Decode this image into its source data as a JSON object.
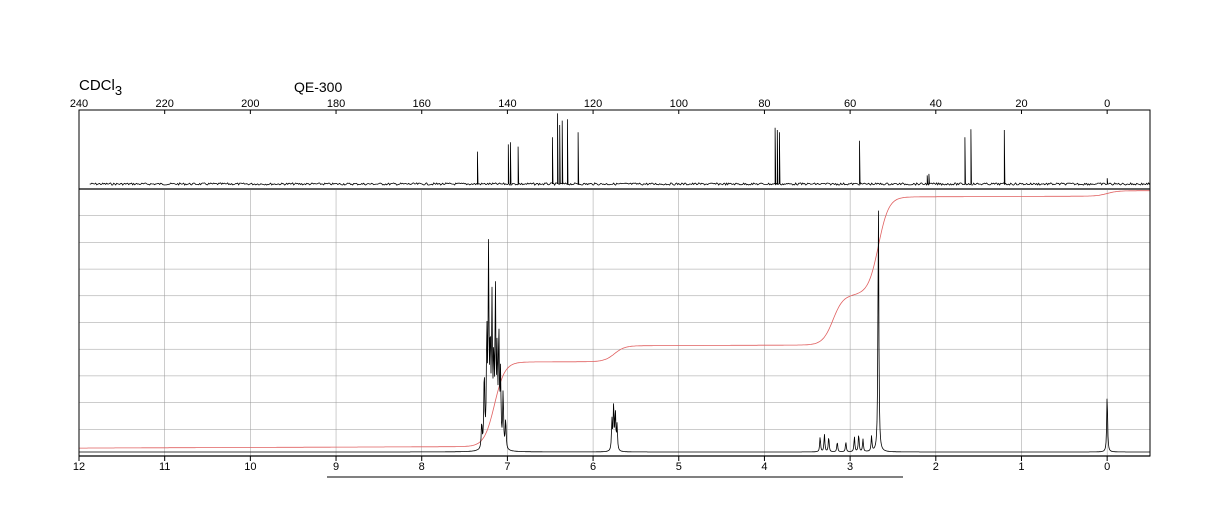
{
  "header": {
    "solvent_main": "CDCl",
    "solvent_sub": "3",
    "instrument": "QE-300"
  },
  "chart_data": [
    {
      "type": "line",
      "name_note": "13C NMR spectrum (top panel)",
      "x_ticks": [
        240,
        220,
        200,
        180,
        160,
        140,
        120,
        100,
        80,
        60,
        40,
        20,
        0
      ],
      "x_tick_labels": [
        "240",
        "220",
        "200",
        "180",
        "160",
        "140",
        "120",
        "100",
        "80",
        "60",
        "40",
        "20",
        "0"
      ],
      "xlim": [
        240,
        -10
      ],
      "x_reversed": true,
      "grid": false,
      "peaks": [
        {
          "ppm": 147.0,
          "h": 0.45
        },
        {
          "ppm": 139.8,
          "h": 0.55
        },
        {
          "ppm": 139.3,
          "h": 0.58
        },
        {
          "ppm": 137.5,
          "h": 0.52
        },
        {
          "ppm": 129.5,
          "h": 0.65
        },
        {
          "ppm": 128.3,
          "h": 0.98
        },
        {
          "ppm": 127.8,
          "h": 0.82
        },
        {
          "ppm": 127.2,
          "h": 0.88
        },
        {
          "ppm": 126.0,
          "h": 0.9
        },
        {
          "ppm": 123.5,
          "h": 0.72
        },
        {
          "ppm": 77.5,
          "h": 0.78
        },
        {
          "ppm": 77.0,
          "h": 0.75
        },
        {
          "ppm": 76.5,
          "h": 0.72
        },
        {
          "ppm": 57.8,
          "h": 0.6
        },
        {
          "ppm": 42.0,
          "h": 0.12
        },
        {
          "ppm": 41.6,
          "h": 0.14
        },
        {
          "ppm": 33.2,
          "h": 0.65
        },
        {
          "ppm": 31.8,
          "h": 0.76
        },
        {
          "ppm": 24.0,
          "h": 0.75
        },
        {
          "ppm": 0.0,
          "h": 0.08
        }
      ]
    },
    {
      "type": "line",
      "name_note": "1H NMR spectrum with integral curve (bottom panel)",
      "x_ticks": [
        12,
        11,
        10,
        9,
        8,
        7,
        6,
        5,
        4,
        3,
        2,
        1,
        0
      ],
      "x_tick_labels": [
        "12",
        "11",
        "10",
        "9",
        "8",
        "7",
        "6",
        "5",
        "4",
        "3",
        "2",
        "1",
        "0"
      ],
      "xlim": [
        12,
        -0.5
      ],
      "x_reversed": true,
      "grid": true,
      "grid_rows": 10,
      "peaks": [
        {
          "ppm": 7.3,
          "h": 0.1
        },
        {
          "ppm": 7.27,
          "h": 0.3
        },
        {
          "ppm": 7.24,
          "h": 0.45
        },
        {
          "ppm": 7.22,
          "h": 0.75
        },
        {
          "ppm": 7.2,
          "h": 0.38
        },
        {
          "ppm": 7.18,
          "h": 0.55
        },
        {
          "ppm": 7.16,
          "h": 0.32
        },
        {
          "ppm": 7.14,
          "h": 0.6
        },
        {
          "ppm": 7.12,
          "h": 0.35
        },
        {
          "ppm": 7.1,
          "h": 0.45
        },
        {
          "ppm": 7.08,
          "h": 0.28
        },
        {
          "ppm": 7.05,
          "h": 0.22
        },
        {
          "ppm": 7.02,
          "h": 0.12
        },
        {
          "ppm": 5.78,
          "h": 0.12
        },
        {
          "ppm": 5.76,
          "h": 0.18
        },
        {
          "ppm": 5.74,
          "h": 0.15
        },
        {
          "ppm": 5.72,
          "h": 0.1
        },
        {
          "ppm": 3.35,
          "h": 0.06
        },
        {
          "ppm": 3.3,
          "h": 0.07
        },
        {
          "ppm": 3.25,
          "h": 0.06
        },
        {
          "ppm": 3.15,
          "h": 0.04
        },
        {
          "ppm": 3.05,
          "h": 0.04
        },
        {
          "ppm": 2.95,
          "h": 0.06
        },
        {
          "ppm": 2.9,
          "h": 0.07
        },
        {
          "ppm": 2.85,
          "h": 0.05
        },
        {
          "ppm": 2.75,
          "h": 0.06
        },
        {
          "ppm": 2.67,
          "h": 0.99
        },
        {
          "ppm": 0.0,
          "h": 0.23
        }
      ],
      "integral_steps": [
        {
          "ppm": 7.15,
          "level": 0.35
        },
        {
          "ppm": 5.75,
          "level": 0.41
        },
        {
          "ppm": 3.2,
          "level": 0.6
        },
        {
          "ppm": 2.67,
          "level": 0.97
        },
        {
          "ppm": 0.0,
          "level": 0.99
        }
      ],
      "integral_start_level": 0.03,
      "colors": {
        "spectrum": "#000000",
        "integral": "#e06060",
        "grid": "#999999"
      }
    }
  ]
}
